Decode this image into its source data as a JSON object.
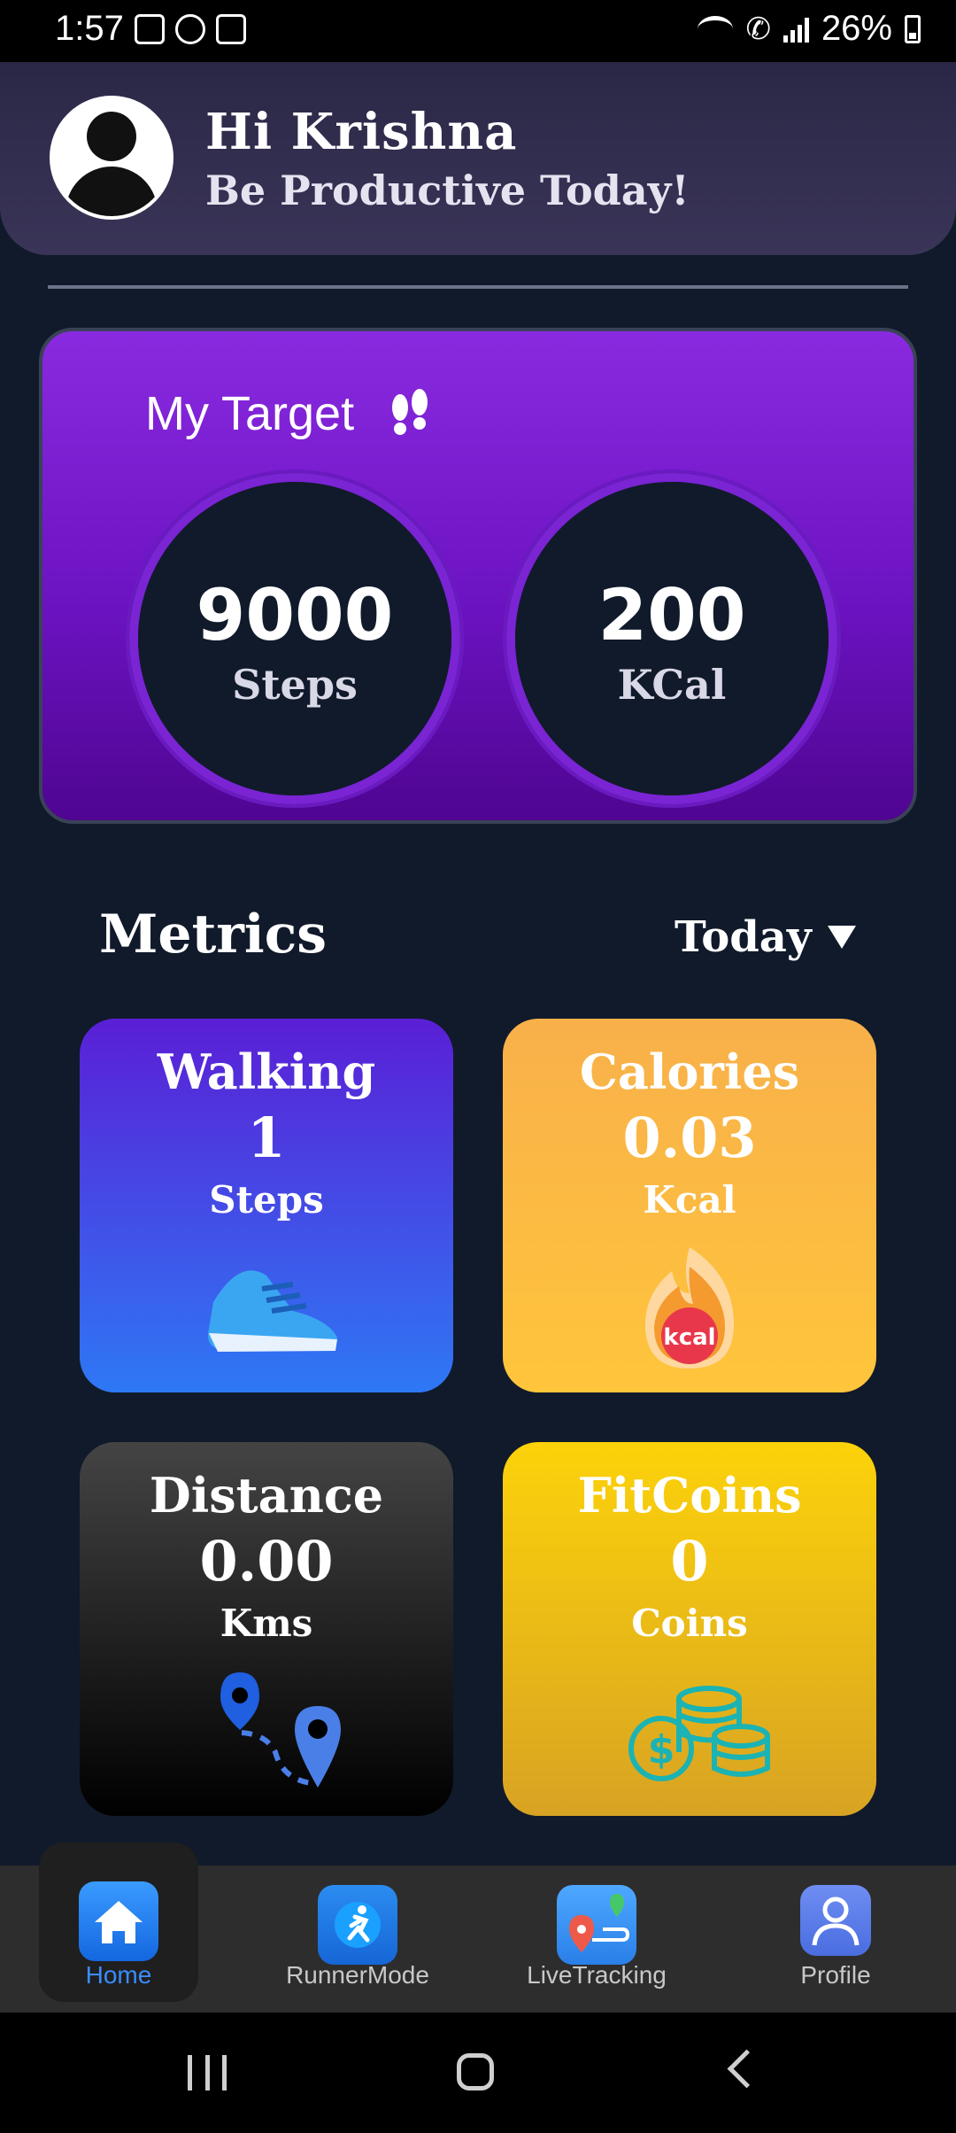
{
  "status_bar": {
    "time": "1:57",
    "battery": "26%"
  },
  "header": {
    "greeting": "Hi Krishna",
    "subtitle": "Be Productive Today!"
  },
  "target": {
    "title": "My Target",
    "steps": {
      "value": "9000",
      "unit": "Steps"
    },
    "kcal": {
      "value": "200",
      "unit": "KCal"
    }
  },
  "metrics": {
    "title": "Metrics",
    "period": "Today",
    "tiles": [
      {
        "title": "Walking",
        "value": "1",
        "unit": "Steps"
      },
      {
        "title": "Calories",
        "value": "0.03",
        "unit": "Kcal",
        "badge": "kcal"
      },
      {
        "title": "Distance",
        "value": "0.00",
        "unit": "Kms"
      },
      {
        "title": "FitCoins",
        "value": "0",
        "unit": "Coins"
      }
    ]
  },
  "nav": [
    {
      "label": "Home",
      "icon": "home-icon"
    },
    {
      "label": "RunnerMode",
      "icon": "runner-icon"
    },
    {
      "label": "LiveTracking",
      "icon": "map-pin-icon"
    },
    {
      "label": "Profile",
      "icon": "profile-icon"
    }
  ],
  "colors": {
    "background": "#111a2b",
    "accent_purple": "#7a24d4",
    "active_nav": "#3b8cff"
  }
}
